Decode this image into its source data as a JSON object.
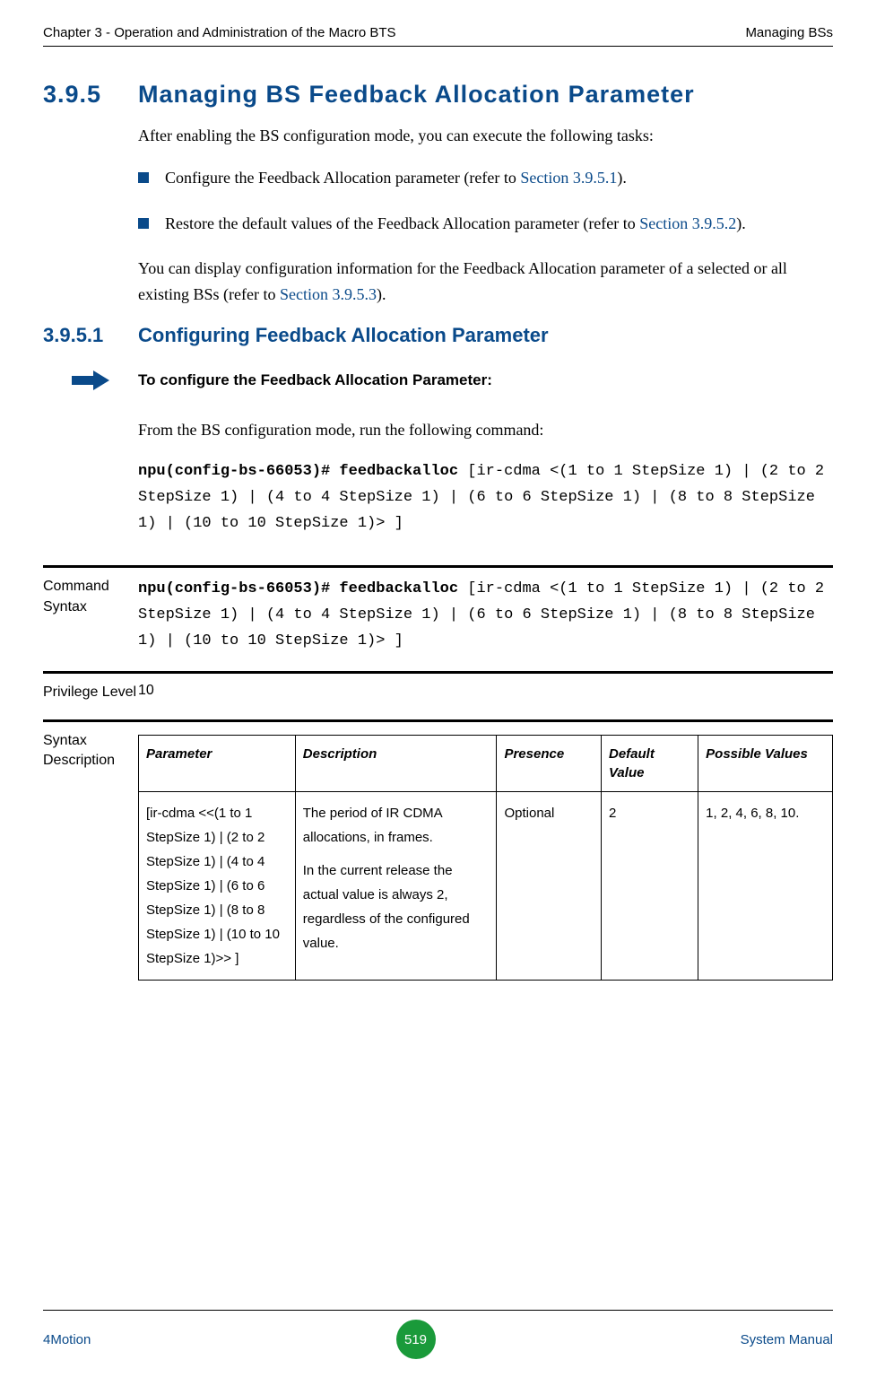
{
  "header": {
    "left": "Chapter 3 - Operation and Administration of the Macro BTS",
    "right": "Managing BSs"
  },
  "section": {
    "num": "3.9.5",
    "title": "Managing BS Feedback Allocation Parameter",
    "intro": "After enabling the BS configuration mode, you can execute the following tasks:",
    "bullets": [
      {
        "pre": "Configure the Feedback Allocation parameter (refer to ",
        "link": "Section 3.9.5.1",
        "post": ")."
      },
      {
        "pre": "Restore the default values of the Feedback Allocation parameter (refer to ",
        "link": "Section 3.9.5.2",
        "post": ")."
      }
    ],
    "tail_pre": "You can display configuration information for the Feedback Allocation parameter of a selected or all existing BSs (refer to ",
    "tail_link": "Section 3.9.5.3",
    "tail_post": ")."
  },
  "subsection": {
    "num": "3.9.5.1",
    "title": "Configuring Feedback Allocation Parameter",
    "to_configure": "To configure the Feedback Allocation Parameter:",
    "from_text": "From the BS configuration mode, run the following command:",
    "cmd_bold": "npu(config-bs-66053)# feedbackalloc ",
    "cmd_rest": "[ir-cdma <(1 to 1 StepSize 1) | (2 to 2 StepSize 1) | (4 to 4 StepSize 1) | (6 to 6 StepSize 1) | (8 to 8 StepSize 1) | (10 to 10 StepSize 1)> ]"
  },
  "defs": {
    "command_syntax_label": "Command Syntax",
    "command_syntax_bold": "npu(config-bs-66053)# feedbackalloc ",
    "command_syntax_rest": "[ir-cdma <(1 to 1 StepSize 1) | (2 to 2 StepSize 1) | (4 to 4 StepSize 1) | (6 to 6 StepSize 1) | (8 to 8 StepSize 1) | (10 to 10 StepSize 1)> ]",
    "privilege_label": "Privilege Level",
    "privilege_value": "10",
    "syntax_desc_label": "Syntax Description"
  },
  "table": {
    "headers": {
      "parameter": "Parameter",
      "description": "Description",
      "presence": "Presence",
      "default": "Default Value",
      "possible": "Possible Values"
    },
    "row": {
      "parameter": "[ir-cdma <<(1 to 1 StepSize 1) | (2 to 2 StepSize 1) | (4 to 4 StepSize 1) | (6 to 6 StepSize 1) | (8 to 8 StepSize 1) | (10 to 10 StepSize 1)>> ]",
      "desc1": "The period of IR CDMA allocations, in frames.",
      "desc2": "In the current release the actual value is always 2, regardless of the configured value.",
      "presence": "Optional",
      "default": "2",
      "possible": "1, 2, 4, 6, 8, 10."
    }
  },
  "footer": {
    "left": "4Motion",
    "page": "519",
    "right": "System Manual"
  }
}
